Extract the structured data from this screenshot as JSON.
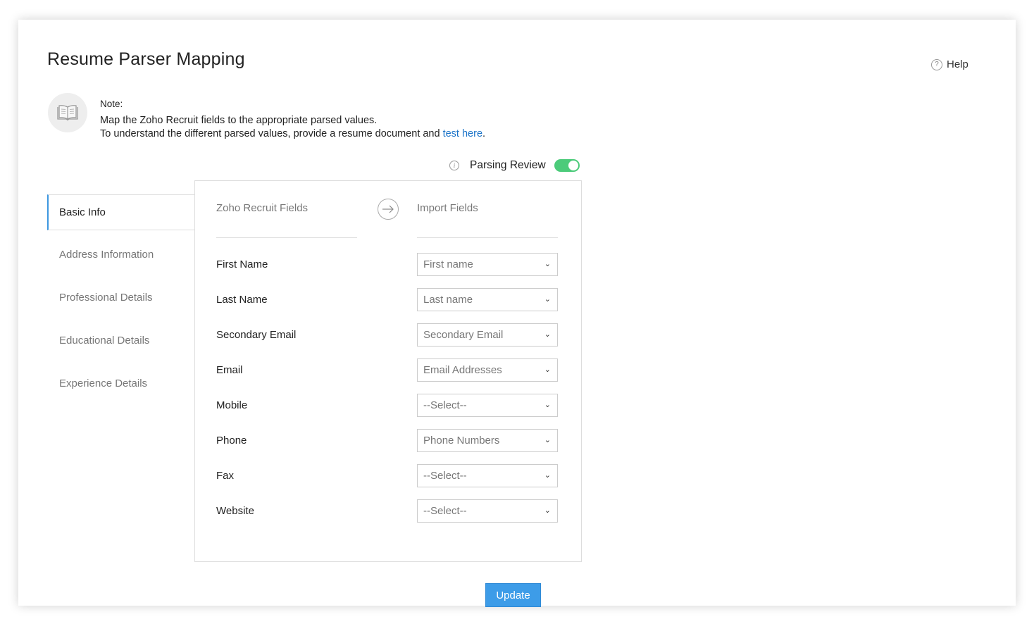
{
  "header": {
    "title": "Resume Parser Mapping",
    "help_icon": "?",
    "help_label": "Help"
  },
  "note": {
    "label": "Note:",
    "line1": "Map the Zoho Recruit fields to the appropriate parsed values.",
    "line2_prefix": "To understand the different parsed values, provide a resume document and ",
    "link_text": "test here",
    "line2_suffix": "."
  },
  "parsing_review": {
    "info_icon": "i",
    "label": "Parsing Review",
    "enabled": true,
    "toggle_color": "#4ccb7a"
  },
  "sidebar": {
    "items": [
      {
        "label": "Basic Info",
        "active": true
      },
      {
        "label": "Address Information",
        "active": false
      },
      {
        "label": "Professional Details",
        "active": false
      },
      {
        "label": "Educational Details",
        "active": false
      },
      {
        "label": "Experience Details",
        "active": false
      }
    ]
  },
  "mapping": {
    "left_header": "Zoho Recruit Fields",
    "right_header": "Import Fields",
    "rows": [
      {
        "field": "First Name",
        "value": "First name"
      },
      {
        "field": "Last Name",
        "value": "Last name"
      },
      {
        "field": "Secondary Email",
        "value": "Secondary Email"
      },
      {
        "field": "Email",
        "value": "Email Addresses"
      },
      {
        "field": "Mobile",
        "value": "--Select--"
      },
      {
        "field": "Phone",
        "value": "Phone Numbers"
      },
      {
        "field": "Fax",
        "value": "--Select--"
      },
      {
        "field": "Website",
        "value": "--Select--"
      }
    ]
  },
  "footer": {
    "update_label": "Update",
    "accent_color": "#3d9ce8"
  }
}
